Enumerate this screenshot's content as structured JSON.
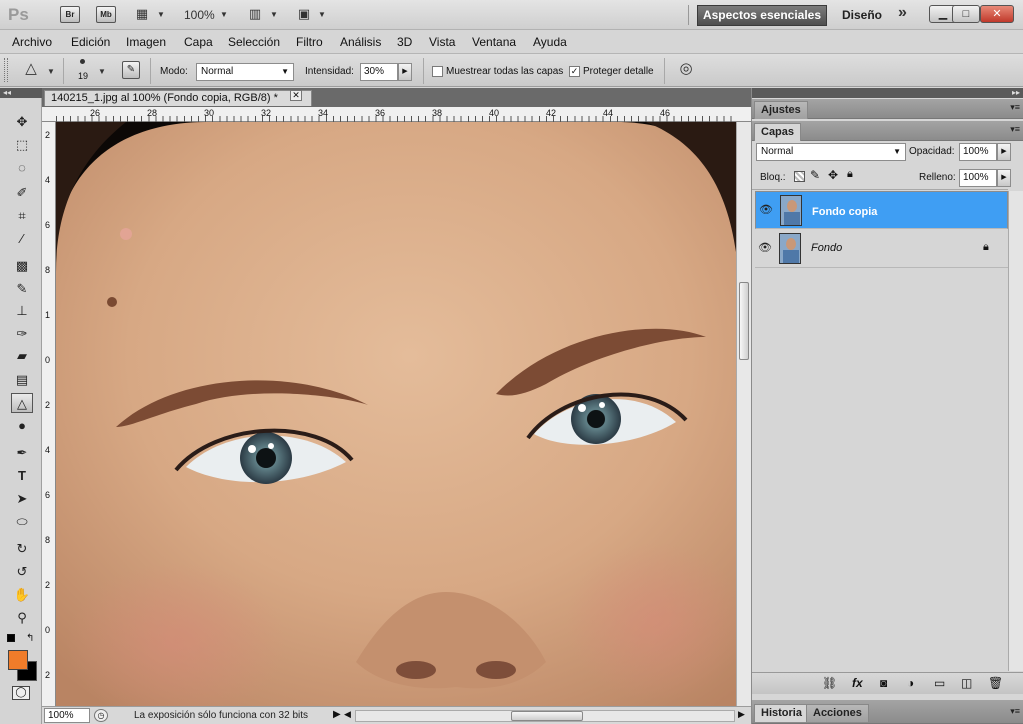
{
  "appbar": {
    "logo": "Ps",
    "bridge_label": "Br",
    "minibridge_label": "Mb",
    "zoom": "100%",
    "workspace_active": "Aspectos esenciales",
    "workspace_other": "Diseño",
    "more": "»"
  },
  "menu": [
    "Archivo",
    "Edición",
    "Imagen",
    "Capa",
    "Selección",
    "Filtro",
    "Análisis",
    "3D",
    "Vista",
    "Ventana",
    "Ayuda"
  ],
  "options": {
    "brush_size": "19",
    "mode_label": "Modo:",
    "mode_value": "Normal",
    "intensity_label": "Intensidad:",
    "intensity_value": "30%",
    "sample_all_label": "Muestrear todas las capas",
    "sample_all_checked": false,
    "protect_label": "Proteger detalle",
    "protect_checked": true
  },
  "document": {
    "tab_title": "140215_1.jpg al 100% (Fondo copia, RGB/8) *",
    "hruler": [
      "26",
      "28",
      "30",
      "32",
      "34",
      "36",
      "38",
      "40",
      "42",
      "44",
      "46"
    ],
    "vruler": [
      "2",
      "4",
      "6",
      "8",
      "1",
      "0",
      "2",
      "4",
      "6",
      "8",
      "2",
      "0",
      "2"
    ],
    "status_zoom": "100%",
    "status_message": "La exposición sólo funciona con 32 bits"
  },
  "panels": {
    "adjust_tab": "Ajustes",
    "layers_tab": "Capas",
    "blend_mode": "Normal",
    "opacity_label": "Opacidad:",
    "opacity_value": "100%",
    "lock_label": "Bloq.:",
    "fill_label": "Relleno:",
    "fill_value": "100%",
    "layers": [
      {
        "name": "Fondo copia",
        "selected": true
      },
      {
        "name": "Fondo",
        "selected": false
      }
    ],
    "history_tab": "Historia",
    "actions_tab": "Acciones"
  },
  "colors": {
    "foreground": "#f07c2a",
    "background": "#000000",
    "selected_layer": "#3f9ef3"
  }
}
